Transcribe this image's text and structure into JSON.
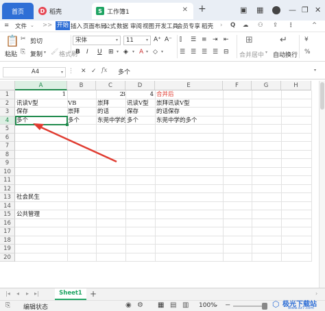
{
  "titlebar": {
    "tabs": [
      {
        "label": "首页",
        "active": false
      },
      {
        "label": "稻壳",
        "active": false
      },
      {
        "label": "工作簿1",
        "active": true
      }
    ],
    "new_tab": "+",
    "accent": "#2f6fd6",
    "docer_color": "#e64552",
    "sheet_icon_color": "#1fa463"
  },
  "menubar": {
    "file": "文件",
    "items": [
      "开始",
      "插入",
      "页面布局",
      "公式",
      "数据",
      "审阅",
      "视图",
      "开发工具",
      "会员专享",
      "稻壳"
    ],
    "more": ">>",
    "search": "Q"
  },
  "ribbon": {
    "paste": "粘贴",
    "cut": "剪切",
    "copy": "复制",
    "format_painter": "格式刷",
    "font_name": "宋体",
    "font_size": "11",
    "bold": "B",
    "italic": "I",
    "underline": "U",
    "merge_center": "合并居中",
    "wrap_text": "自动换行"
  },
  "formulabar": {
    "name_box": "A4",
    "cancel": "✕",
    "confirm": "✓",
    "fx": "fx",
    "content": "多个"
  },
  "sheet": {
    "columns": [
      "A",
      "B",
      "C",
      "D",
      "E",
      "F",
      "G",
      "H"
    ],
    "rows": [
      "1",
      "2",
      "3",
      "4",
      "5",
      "6",
      "7",
      "8",
      "9",
      "10",
      "11",
      "12",
      "13",
      "14",
      "15",
      "16",
      "17",
      "18",
      "19",
      "20"
    ],
    "cells": {
      "A1": "1",
      "C1": "2",
      "D1": "3",
      "D1b": "4",
      "E1": "合并后",
      "A2": "讯读V型",
      "B2": "VB",
      "C2": "崇拜",
      "D2": "讯读V型",
      "E2": "崇拜讯读V型",
      "A3": "保存",
      "B3": "崇拜",
      "C3": "的话",
      "D3": "保存",
      "E3": "的话保存",
      "A4": "多个",
      "B4": "多个",
      "C4": "东莞中学的",
      "D4": "多个",
      "E4": "东莞中学的多个",
      "A12": "社会民生",
      "A14": "公共管理"
    },
    "red_text_color": "#e03c31",
    "arrow_color": "#e03c31",
    "selected_cell": "A4"
  },
  "sheetbar": {
    "sheet_tab": "Sheet1",
    "add": "+"
  },
  "statusbar": {
    "mode": "编辑状态",
    "zoom": "100%",
    "minus": "−",
    "watermark": "极光下载站",
    "watermark_url": "www.xz7.com"
  }
}
